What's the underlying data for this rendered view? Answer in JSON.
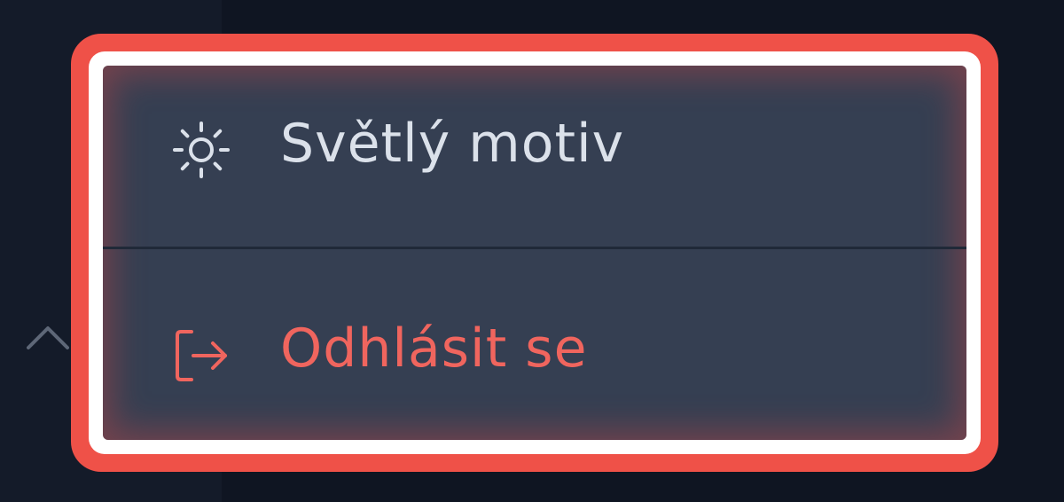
{
  "menu": {
    "items": [
      {
        "label": "Světlý motiv",
        "icon": "sun-icon"
      },
      {
        "label": "Odhlásit se",
        "icon": "logout-icon"
      }
    ]
  },
  "colors": {
    "menu_background": "#353f52",
    "highlight_border": "#ef5148",
    "logout_text": "#f0655e",
    "theme_text": "#dbe1ea",
    "page_background": "#0f1522"
  },
  "sidebar": {
    "toggle_icon": "chevron-up-icon"
  }
}
